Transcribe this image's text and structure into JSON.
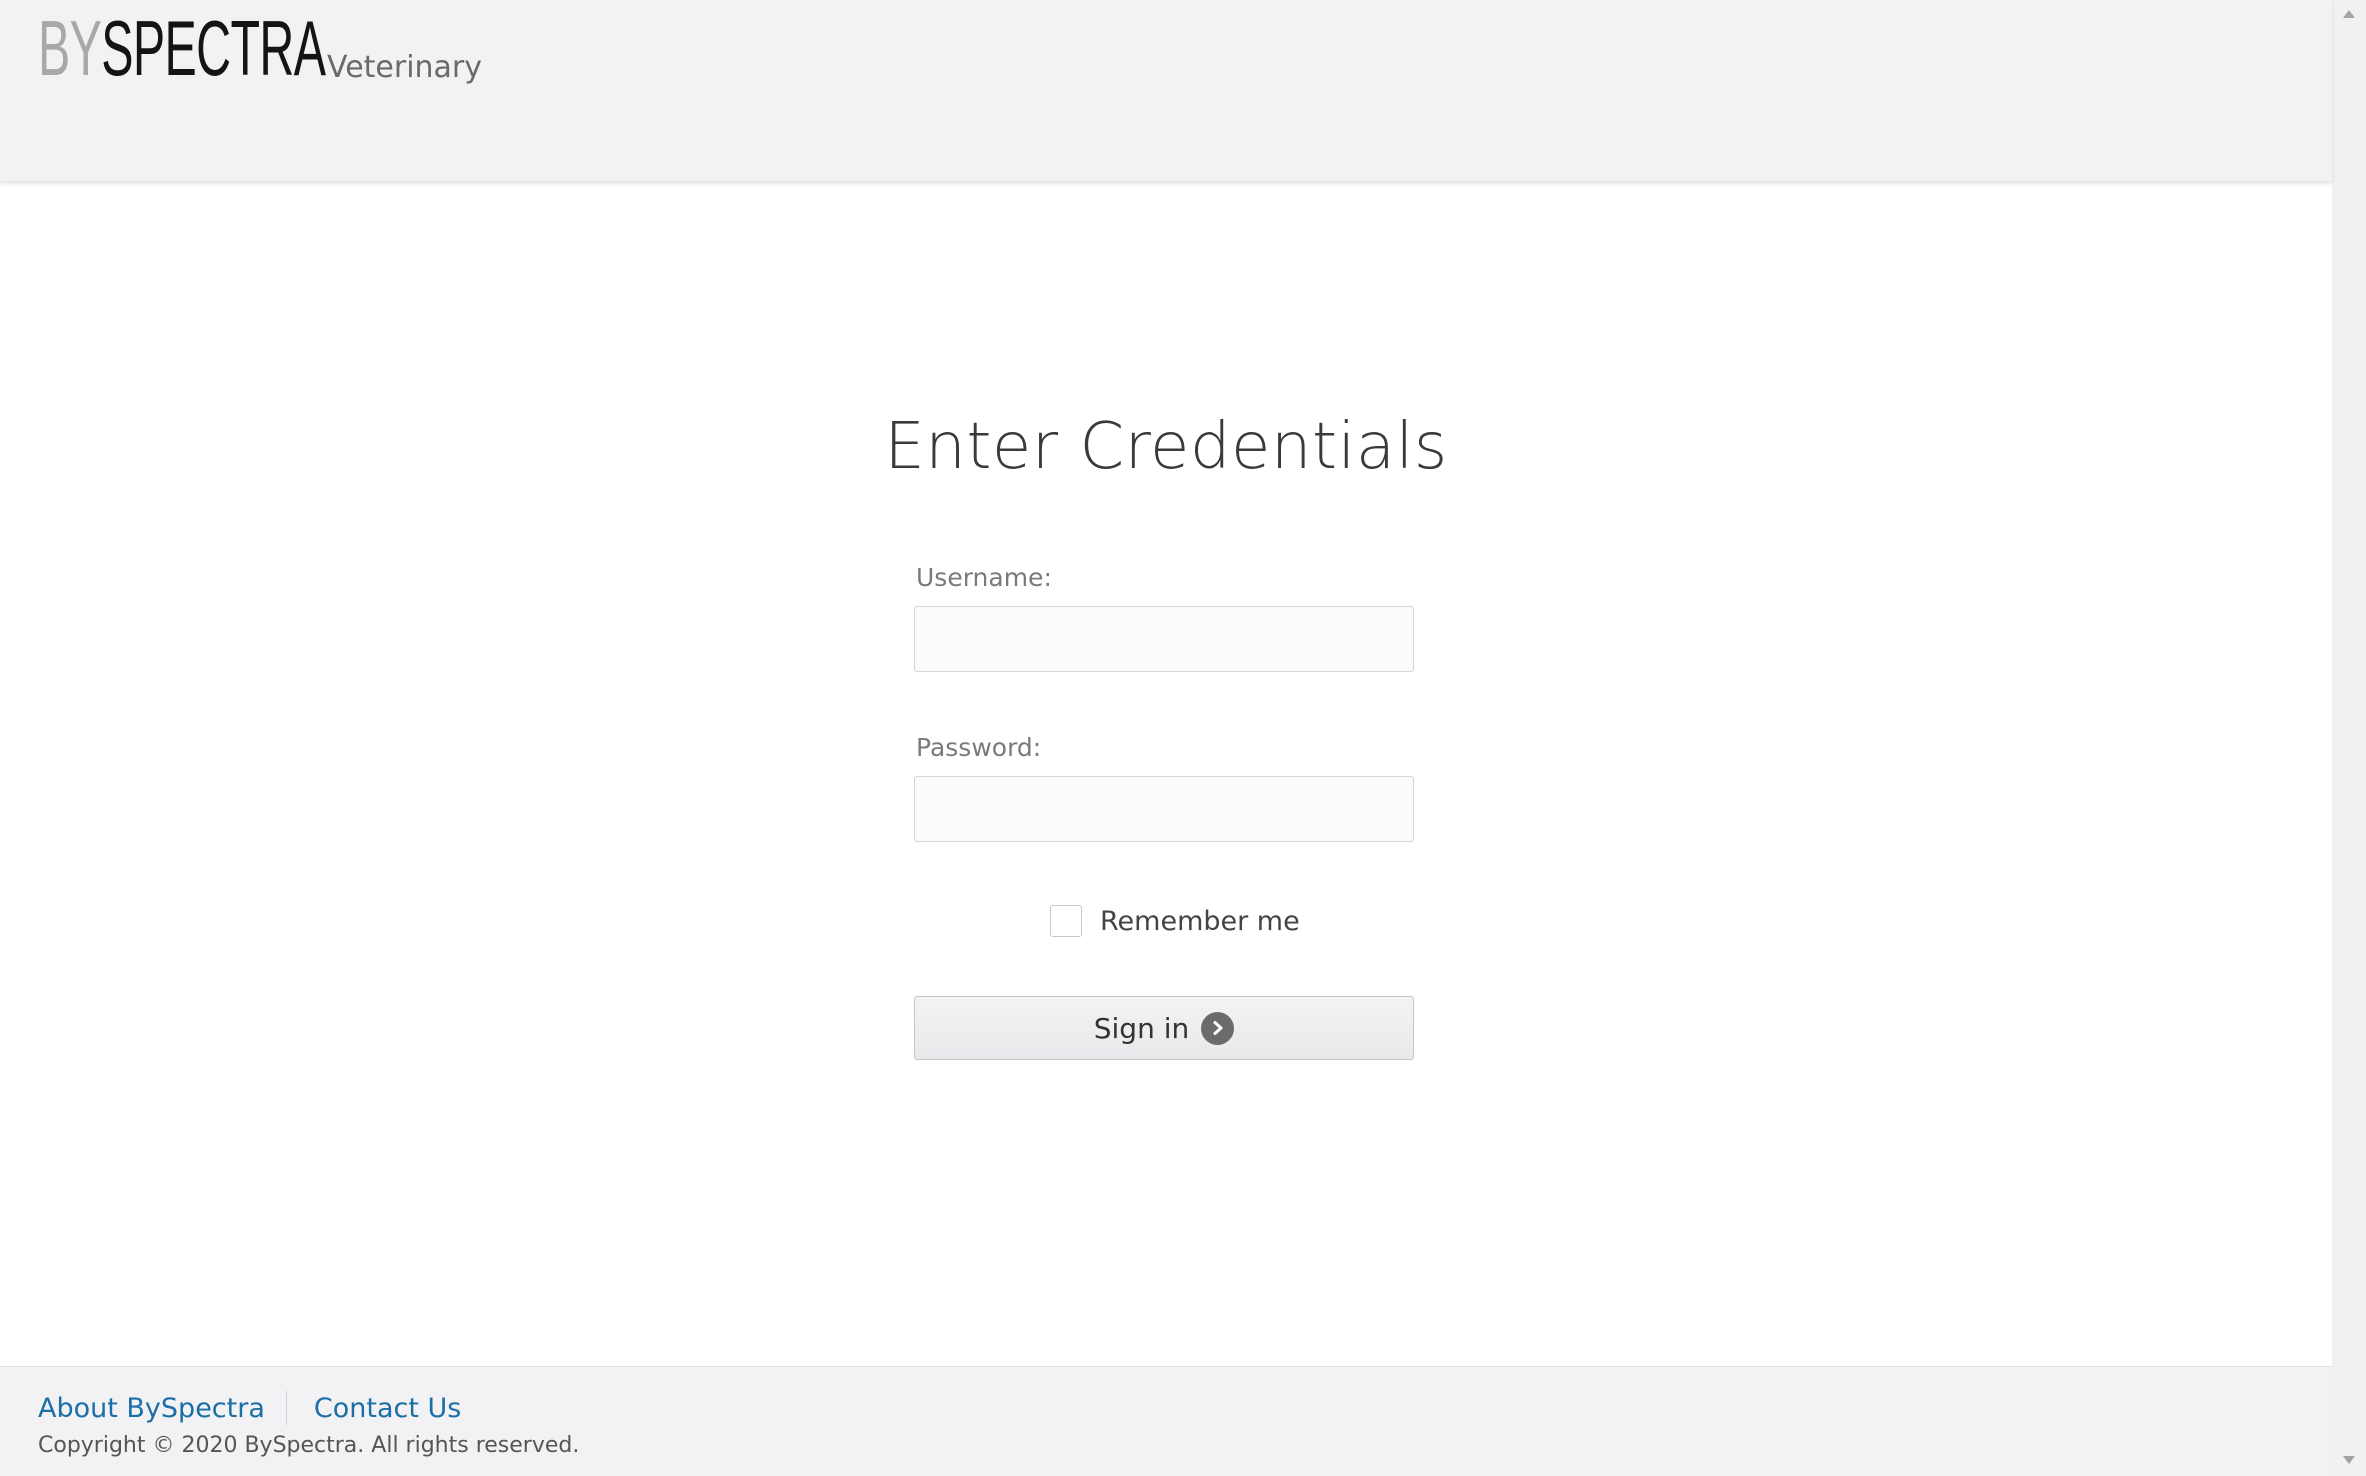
{
  "header": {
    "logo_by": "BY",
    "logo_spectra": "SPECTRA",
    "product": "Veterinary"
  },
  "login": {
    "title": "Enter Credentials",
    "username_label": "Username:",
    "username_value": "",
    "password_label": "Password:",
    "password_value": "",
    "remember_label": "Remember me",
    "remember_checked": false,
    "signin_label": "Sign in",
    "signin_icon": "chevron-right-circle-icon"
  },
  "footer": {
    "links": [
      "About BySpectra",
      "Contact Us"
    ],
    "copyright": "Copyright © 2020 BySpectra. All rights reserved."
  },
  "colors": {
    "header_bg": "#f2f2f4",
    "link": "#1a6fa6",
    "logo_by": "#a8a8a8",
    "logo_spectra": "#141414"
  }
}
